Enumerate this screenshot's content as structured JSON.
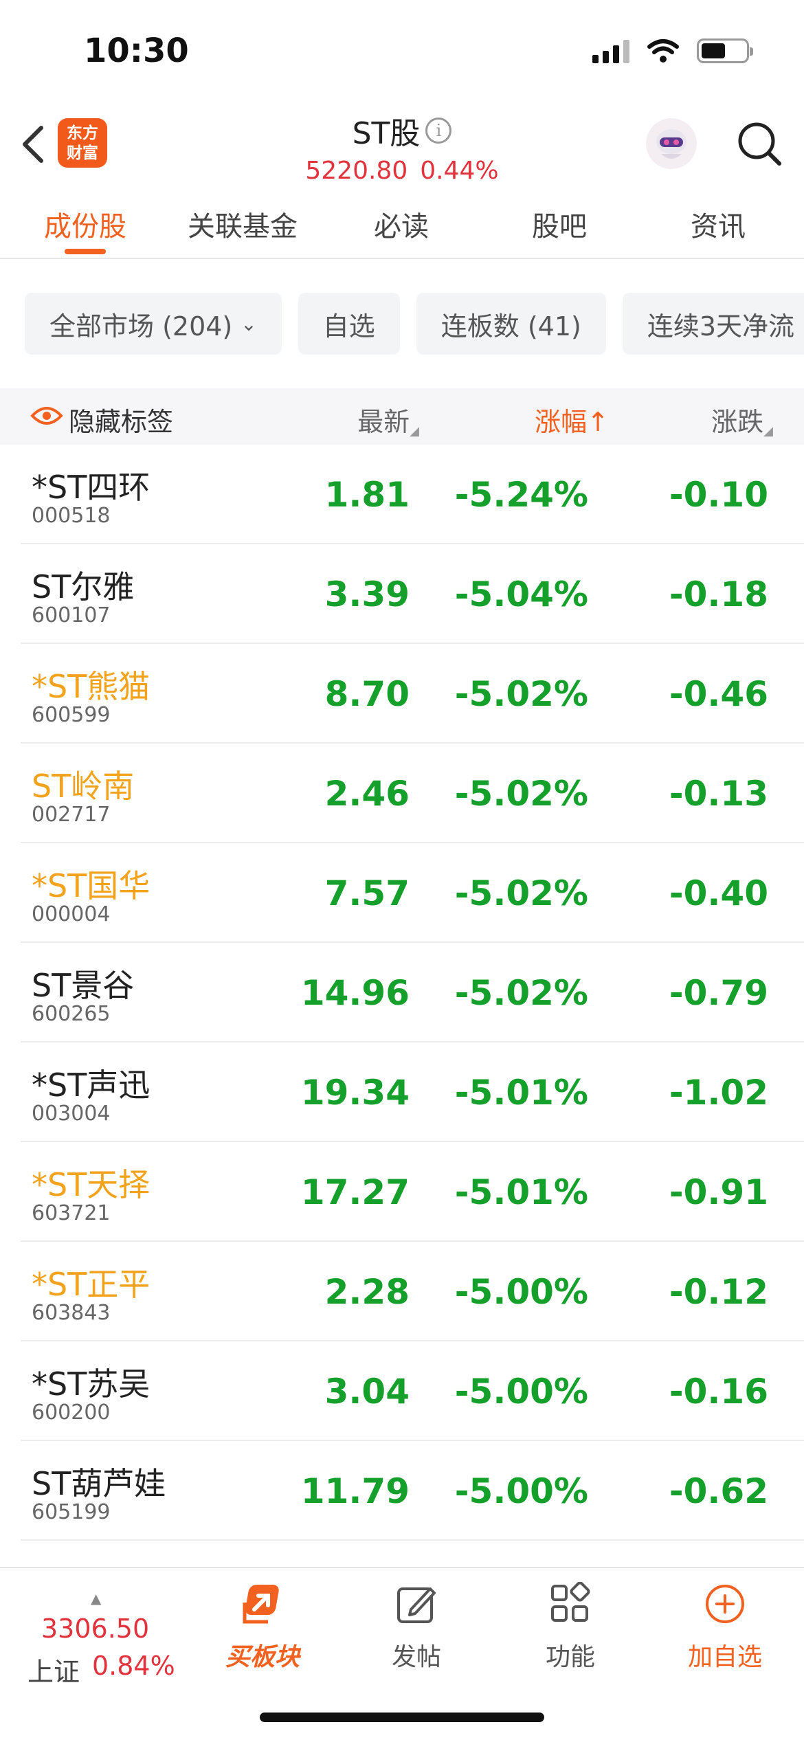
{
  "status": {
    "time": "10:30"
  },
  "header": {
    "logo_line1": "东方",
    "logo_line2": "财富",
    "title": "ST股",
    "index_value": "5220.80",
    "index_change": "0.44%"
  },
  "tabs": [
    {
      "label": "成份股",
      "active": true
    },
    {
      "label": "关联基金",
      "active": false
    },
    {
      "label": "必读",
      "active": false
    },
    {
      "label": "股吧",
      "active": false
    },
    {
      "label": "资讯",
      "active": false
    }
  ],
  "filters": [
    {
      "label": "全部市场 (204)",
      "dropdown": true
    },
    {
      "label": "自选",
      "dropdown": false
    },
    {
      "label": "连板数 (41)",
      "dropdown": false
    },
    {
      "label": "连续3天净流",
      "dropdown": false
    }
  ],
  "columns": {
    "hide_tags": "隐藏标签",
    "latest": "最新",
    "change_pct": "涨幅",
    "change_pct_arrow": "↑",
    "change_abs": "涨跌"
  },
  "colors": {
    "accent": "#f2611f",
    "down": "#14a02b",
    "up": "#e2323c",
    "tag": "#f2a21b"
  },
  "stocks": [
    {
      "name": "*ST四环",
      "code": "000518",
      "price": "1.81",
      "change_pct": "-5.24%",
      "change": "-0.10",
      "tagged": false
    },
    {
      "name": "ST尔雅",
      "code": "600107",
      "price": "3.39",
      "change_pct": "-5.04%",
      "change": "-0.18",
      "tagged": false
    },
    {
      "name": "*ST熊猫",
      "code": "600599",
      "price": "8.70",
      "change_pct": "-5.02%",
      "change": "-0.46",
      "tagged": true
    },
    {
      "name": "ST岭南",
      "code": "002717",
      "price": "2.46",
      "change_pct": "-5.02%",
      "change": "-0.13",
      "tagged": true
    },
    {
      "name": "*ST国华",
      "code": "000004",
      "price": "7.57",
      "change_pct": "-5.02%",
      "change": "-0.40",
      "tagged": true
    },
    {
      "name": "ST景谷",
      "code": "600265",
      "price": "14.96",
      "change_pct": "-5.02%",
      "change": "-0.79",
      "tagged": false
    },
    {
      "name": "*ST声迅",
      "code": "003004",
      "price": "19.34",
      "change_pct": "-5.01%",
      "change": "-1.02",
      "tagged": false
    },
    {
      "name": "*ST天择",
      "code": "603721",
      "price": "17.27",
      "change_pct": "-5.01%",
      "change": "-0.91",
      "tagged": true
    },
    {
      "name": "*ST正平",
      "code": "603843",
      "price": "2.28",
      "change_pct": "-5.00%",
      "change": "-0.12",
      "tagged": true
    },
    {
      "name": "*ST苏吴",
      "code": "600200",
      "price": "3.04",
      "change_pct": "-5.00%",
      "change": "-0.16",
      "tagged": false
    },
    {
      "name": "ST葫芦娃",
      "code": "605199",
      "price": "11.79",
      "change_pct": "-5.00%",
      "change": "-0.62",
      "tagged": false
    }
  ],
  "bottom_bar": {
    "index_value": "3306.50",
    "index_name": "上证",
    "index_change": "0.84%",
    "nav": [
      {
        "label": "买板块",
        "icon": "buy-sector-icon"
      },
      {
        "label": "发帖",
        "icon": "compose-icon"
      },
      {
        "label": "功能",
        "icon": "grid-icon"
      },
      {
        "label": "加自选",
        "icon": "add-circle-icon"
      }
    ]
  }
}
